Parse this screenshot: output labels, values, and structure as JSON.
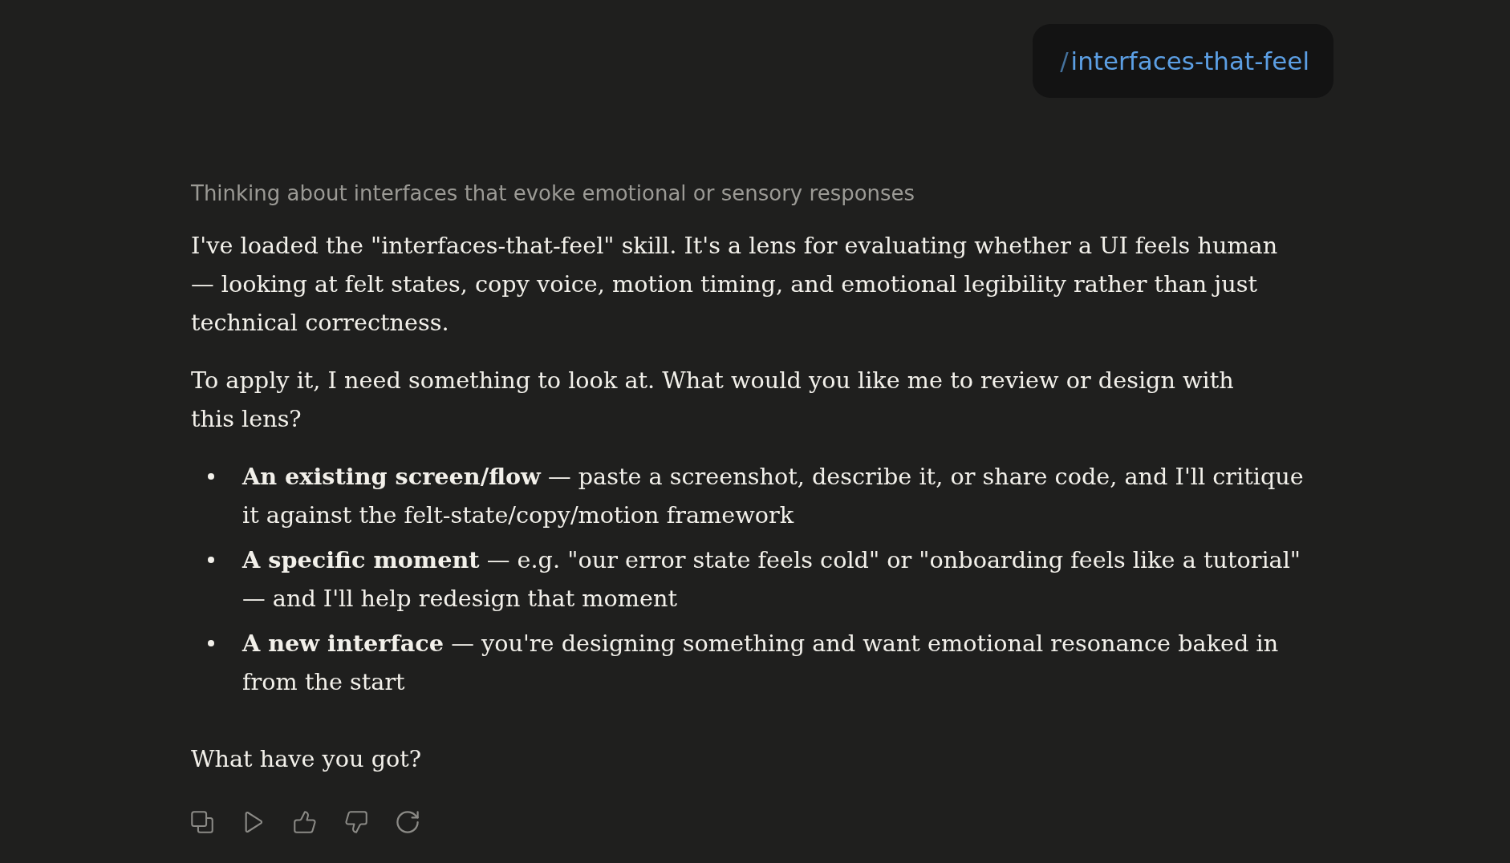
{
  "user_message": {
    "command_prefix": "/",
    "command": "interfaces-that-feel"
  },
  "response": {
    "thinking_summary": "Thinking about interfaces that evoke emotional or sensory responses",
    "paragraphs": [
      "I've loaded the \"interfaces-that-feel\" skill. It's a lens for evaluating whether a UI feels human — looking at felt states, copy voice, motion timing, and emotional legibility rather than just technical correctness.",
      "To apply it, I need something to look at. What would you like me to review or design with this lens?"
    ],
    "options": [
      "**An existing screen/flow** — paste a screenshot, describe it, or share code, and I'll critique it against the felt-state/copy/motion framework",
      "**A specific moment** — e.g. \"our error state feels cold\" or \"onboarding feels like a tutorial\" — and I'll help redesign that moment",
      "**A new interface** — you're designing something and want emotional resonance baked in from the start"
    ],
    "closing": "What have you got?"
  }
}
